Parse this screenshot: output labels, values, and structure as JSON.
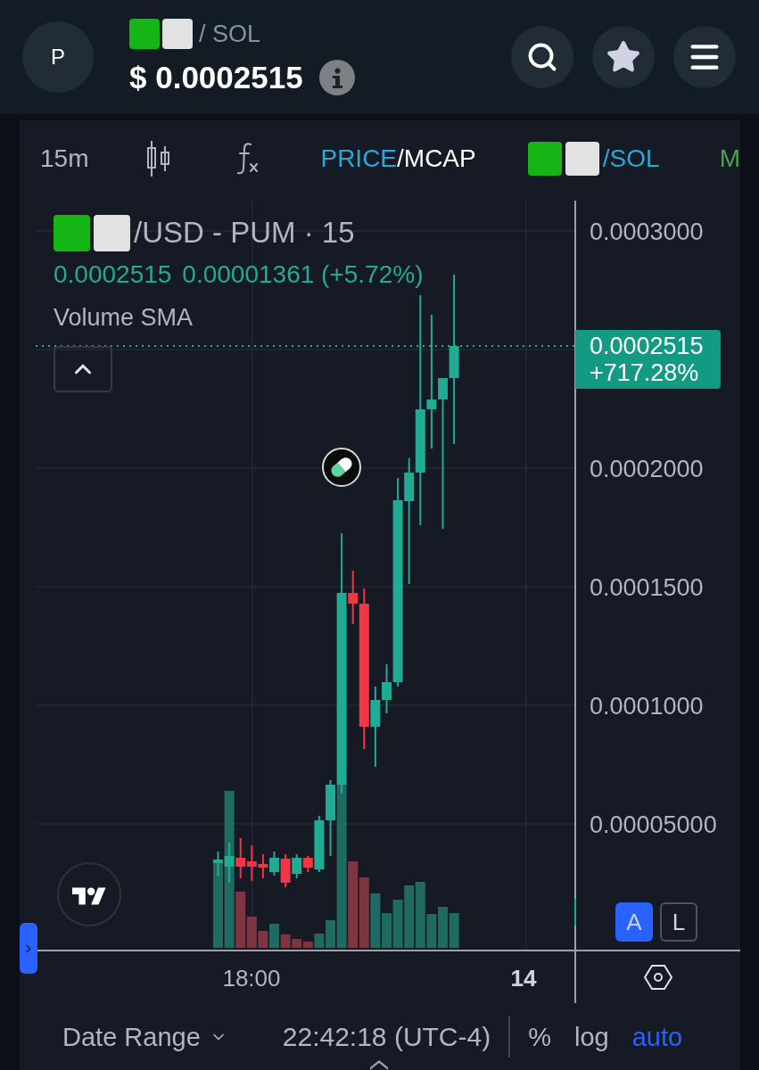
{
  "header": {
    "avatar_letter": "P",
    "token_squares": [
      {
        "color": "#14b514"
      },
      {
        "color": "#e2e2e2"
      }
    ],
    "pair_quote": "/ SOL",
    "price": "$ 0.0002515"
  },
  "toolbar": {
    "interval": "15m",
    "value_modes": [
      {
        "label": "PRICE",
        "selected": true
      },
      {
        "label": "MCAP",
        "selected": false
      }
    ],
    "mode_separator": "/",
    "quote_squares": [
      {
        "color": "#14b514"
      },
      {
        "color": "#e2e2e2"
      }
    ],
    "quote": "/SOL",
    "next_item": "M"
  },
  "legend": {
    "squares": [
      {
        "color": "#14b514"
      },
      {
        "color": "#e2e2e2"
      }
    ],
    "title": "/USD - PUM · 15",
    "values": [
      "0.0002515",
      "0.00001361 (+5.72%)"
    ],
    "indicator": "Volume SMA"
  },
  "price_axis": {
    "ticks": [
      "0.0003000",
      "0.0002000",
      "0.0001500",
      "0.0001000",
      "0.00005000"
    ],
    "last_price": "0.0002515",
    "last_change": "+717.28%"
  },
  "time_axis": [
    {
      "label": "18:00",
      "kind": "time"
    },
    {
      "label": "14",
      "kind": "day"
    }
  ],
  "scale_modes": [
    {
      "label": "A",
      "selected": true
    },
    {
      "label": "L",
      "selected": false
    }
  ],
  "bottom_bar": {
    "date_range": "Date Range",
    "clock": "22:42:18 (UTC-4)",
    "options": [
      {
        "label": "%",
        "selected": false
      },
      {
        "label": "log",
        "selected": false
      },
      {
        "label": "auto",
        "selected": true
      }
    ]
  }
}
